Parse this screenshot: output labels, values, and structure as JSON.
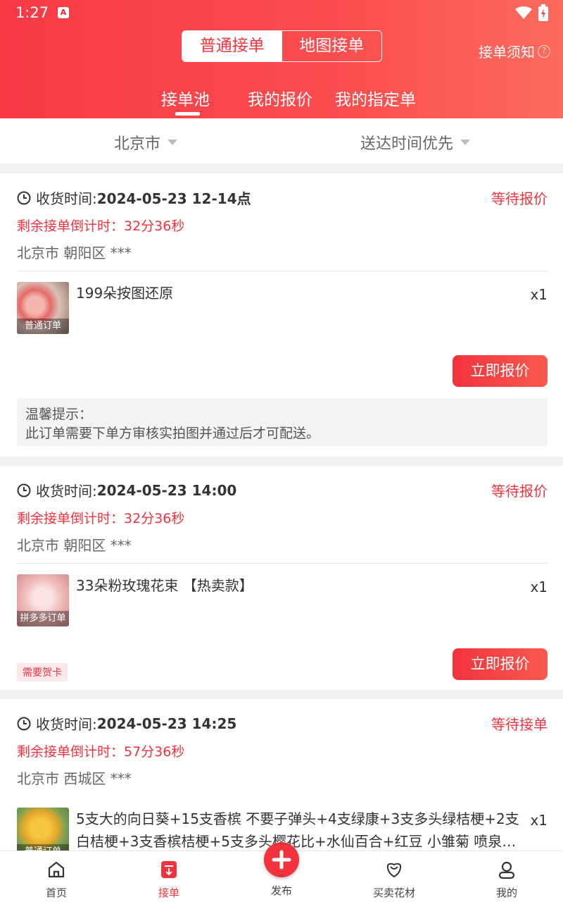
{
  "status_bar": {
    "time": "1:27"
  },
  "header": {
    "segments": [
      "普通接单",
      "地图接单"
    ],
    "notice": "接单须知",
    "tabs": [
      "接单池",
      "我的报价",
      "我的指定单"
    ]
  },
  "filters": {
    "city": "北京市",
    "sort": "送达时间优先"
  },
  "orders": [
    {
      "time_label": "收货时间:",
      "time_value": "2024-05-23 12-14点",
      "status": "等待报价",
      "countdown": "剩余接单倒计时：32分36秒",
      "address": "北京市 朝阳区 ***",
      "product_name": "199朵按图还原",
      "qty": "x1",
      "thumb_label": "普通订单",
      "button": "立即报价",
      "tip_title": "温馨提示：",
      "tip_body": "此订单需要下单方审核实拍图并通过后才可配送。"
    },
    {
      "time_label": "收货时间:",
      "time_value": "2024-05-23 14:00",
      "status": "等待报价",
      "countdown": "剩余接单倒计时：32分36秒",
      "address": "北京市 朝阳区 ***",
      "product_name": "33朵粉玫瑰花束 【热卖款】",
      "qty": "x1",
      "thumb_label": "拼多多订单",
      "badge": "需要贺卡",
      "button": "立即报价"
    },
    {
      "time_label": "收货时间:",
      "time_value": "2024-05-23 14:25",
      "status": "等待接单",
      "countdown": "剩余接单倒计时：57分36秒",
      "address": "北京市 西城区 ***",
      "product_name": "5支大的向日葵+15支香槟 不要子弹头+4支绿康+3支多头绿桔梗+2支白桔梗+3支香槟桔梗+5支多头樱花比+水仙百合+红豆 小雏菊 喷泉…",
      "qty": "x1",
      "thumb_label": "普通订单"
    }
  ],
  "nav": {
    "items": [
      "首页",
      "接单",
      "发布",
      "买卖花材",
      "我的"
    ],
    "active": "接单"
  },
  "colors": {
    "accent": "#f2333d",
    "header_start": "#f83a45",
    "header_end": "#fc6b5c"
  },
  "icons": [
    "clock-icon",
    "help-icon",
    "caret-down-icon",
    "home-icon",
    "order-icon",
    "plus-icon",
    "flower-icon",
    "user-icon"
  ]
}
